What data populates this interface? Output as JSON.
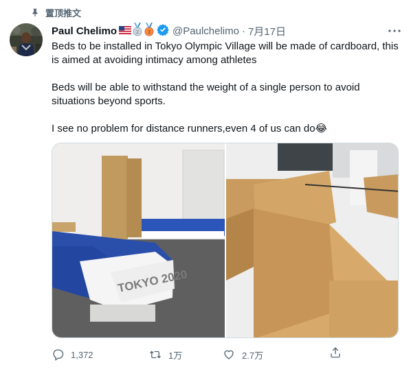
{
  "pinned": {
    "label": "置顶推文"
  },
  "tweet": {
    "author_name": "Paul Chelimo",
    "badges": [
      "us-flag-icon",
      "silver-medal-icon",
      "bronze-medal-icon"
    ],
    "handle": "@Paulchelimo",
    "separator": "·",
    "date": "7月17日",
    "text": "Beds to be installed in Tokyo Olympic Village will be made of cardboard, this is aimed at avoiding intimacy among athletes\n\nBeds will be able to withstand the weight of a single person to avoid situations beyond sports.\n\nI see no problem for distance runners,even 4 of us can do😂",
    "media": {
      "left_photo_text": "TOKYO 2020",
      "right_photo_text": ""
    }
  },
  "actions": {
    "reply_count": "1,372",
    "retweet_count": "1万",
    "like_count": "2.7万"
  },
  "colors": {
    "accent": "#1d9bf0",
    "muted": "#536471"
  }
}
